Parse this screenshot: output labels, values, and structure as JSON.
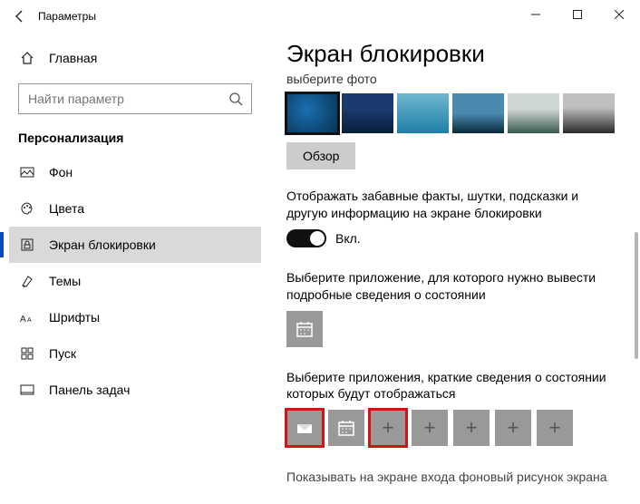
{
  "window": {
    "title": "Параметры"
  },
  "search": {
    "placeholder": "Найти параметр"
  },
  "section": "Персонализация",
  "nav": {
    "home": "Главная",
    "background": "Фон",
    "colors": "Цвета",
    "lockscreen": "Экран блокировки",
    "themes": "Темы",
    "fonts": "Шрифты",
    "start": "Пуск",
    "taskbar": "Панель задач"
  },
  "content": {
    "heading": "Экран блокировки",
    "choose_photo": "выберите фото",
    "browse": "Обзор",
    "fun_facts": "Отображать забавные факты, шутки, подсказки и другую информацию на экране блокировки",
    "toggle_on": "Вкл.",
    "detail_app": "Выберите приложение, для которого нужно вывести подробные сведения о состоянии",
    "quick_apps": "Выберите приложения, краткие сведения о состоянии которых будут отображаться",
    "cutoff": "Показывать на экране входа фоновый рисунок экрана"
  }
}
